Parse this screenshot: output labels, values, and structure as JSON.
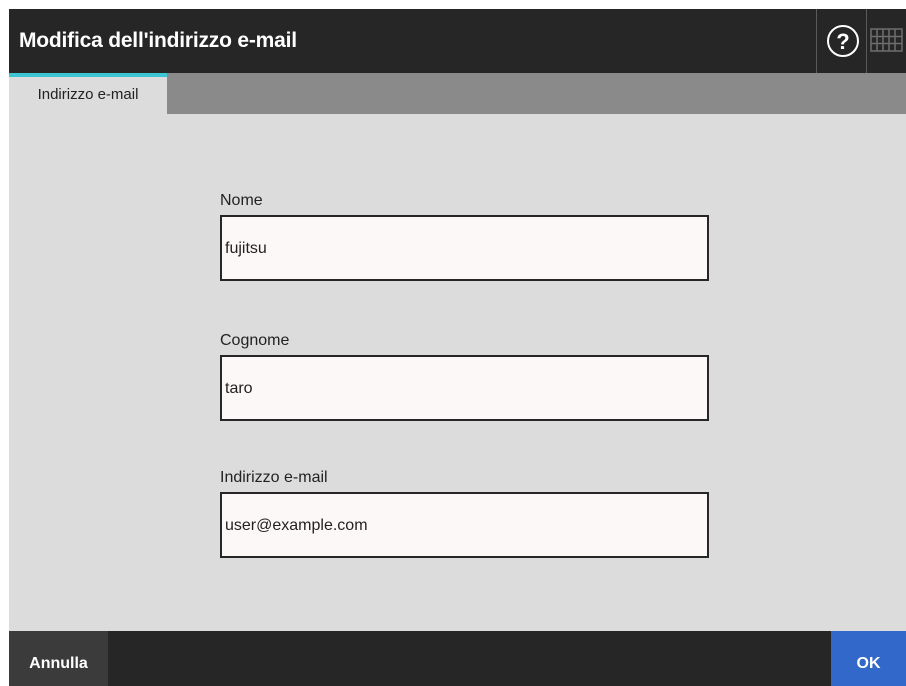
{
  "window": {
    "title": "Modifica dell'indirizzo e-mail"
  },
  "icons": {
    "help": "question-circle-icon",
    "keyboard": "keyboard-icon"
  },
  "tabs": [
    {
      "label": "Indirizzo e-mail",
      "active": true
    }
  ],
  "form": {
    "first_name": {
      "label": "Nome",
      "value": "fujitsu"
    },
    "last_name": {
      "label": "Cognome",
      "value": "taro"
    },
    "email": {
      "label": "Indirizzo e-mail",
      "value": "user@example.com"
    }
  },
  "footer": {
    "cancel_label": "Annulla",
    "ok_label": "OK"
  },
  "colors": {
    "titlebar": "#262626",
    "accent_tab": "#3cc6d4",
    "ok_button": "#3168c9",
    "panel": "#dcdcdc"
  }
}
